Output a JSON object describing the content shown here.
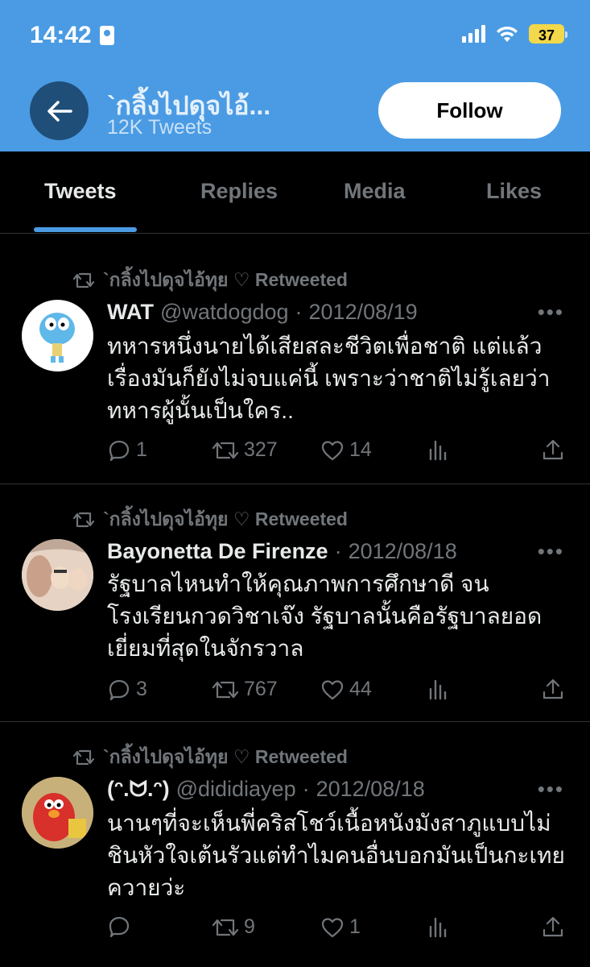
{
  "status_bar": {
    "time": "14:42",
    "battery": "37"
  },
  "header": {
    "name": "`กลิ้งไปดุจไอ้...",
    "tweet_count": "12K Tweets",
    "follow_label": "Follow"
  },
  "tabs": [
    {
      "label": "Tweets"
    },
    {
      "label": "Replies"
    },
    {
      "label": "Media"
    },
    {
      "label": "Likes"
    }
  ],
  "tweets": [
    {
      "retweeted_by": "`กลิ้งไปดุจไอ้ทุย ♡ Retweeted",
      "name": "WAT",
      "handle": "@watdogdog",
      "separator": "·",
      "date": "2012/08/19",
      "text": "ทหารหนึ่งนายได้เสียสละชีวิตเพื่อชาติ แต่แล้วเรื่องมันก็ยังไม่จบแค่นี้ เพราะว่าชาติไม่รู้เลยว่าทหารผู้นั้นเป็นใคร..",
      "replies": "1",
      "retweets": "327",
      "likes": "14"
    },
    {
      "retweeted_by": "`กลิ้งไปดุจไอ้ทุย ♡ Retweeted",
      "name": "Bayonetta De Firenze",
      "handle": "",
      "separator": "·",
      "date": "2012/08/18",
      "text": "รัฐบาลไหนทำให้คุณภาพการศึกษาดี จนโรงเรียนกวดวิชาเจ๊ง รัฐบาลนั้นคือรัฐบาลยอดเยี่ยมที่สุดในจักรวาล",
      "replies": "3",
      "retweets": "767",
      "likes": "44"
    },
    {
      "retweeted_by": "`กลิ้งไปดุจไอ้ทุย ♡ Retweeted",
      "name": "(ᵔ.ᗢ.ᵔ)",
      "handle": "@dididiayep",
      "separator": "·",
      "date": "2012/08/18",
      "text": "นานๆที่จะเห็นพี่คริสโชว์เนื้อหนังมังสาภูแบบไม่ชินหัวใจเต้นรัวแต่ทำไมคนอื่นบอกมันเป็นกะเทยควายว่ะ",
      "replies": "",
      "retweets": "9",
      "likes": "1"
    }
  ],
  "colors": {
    "header_bg": "#4a9be3",
    "accent": "#4a9be3",
    "muted": "#71767b",
    "background": "#000000"
  }
}
